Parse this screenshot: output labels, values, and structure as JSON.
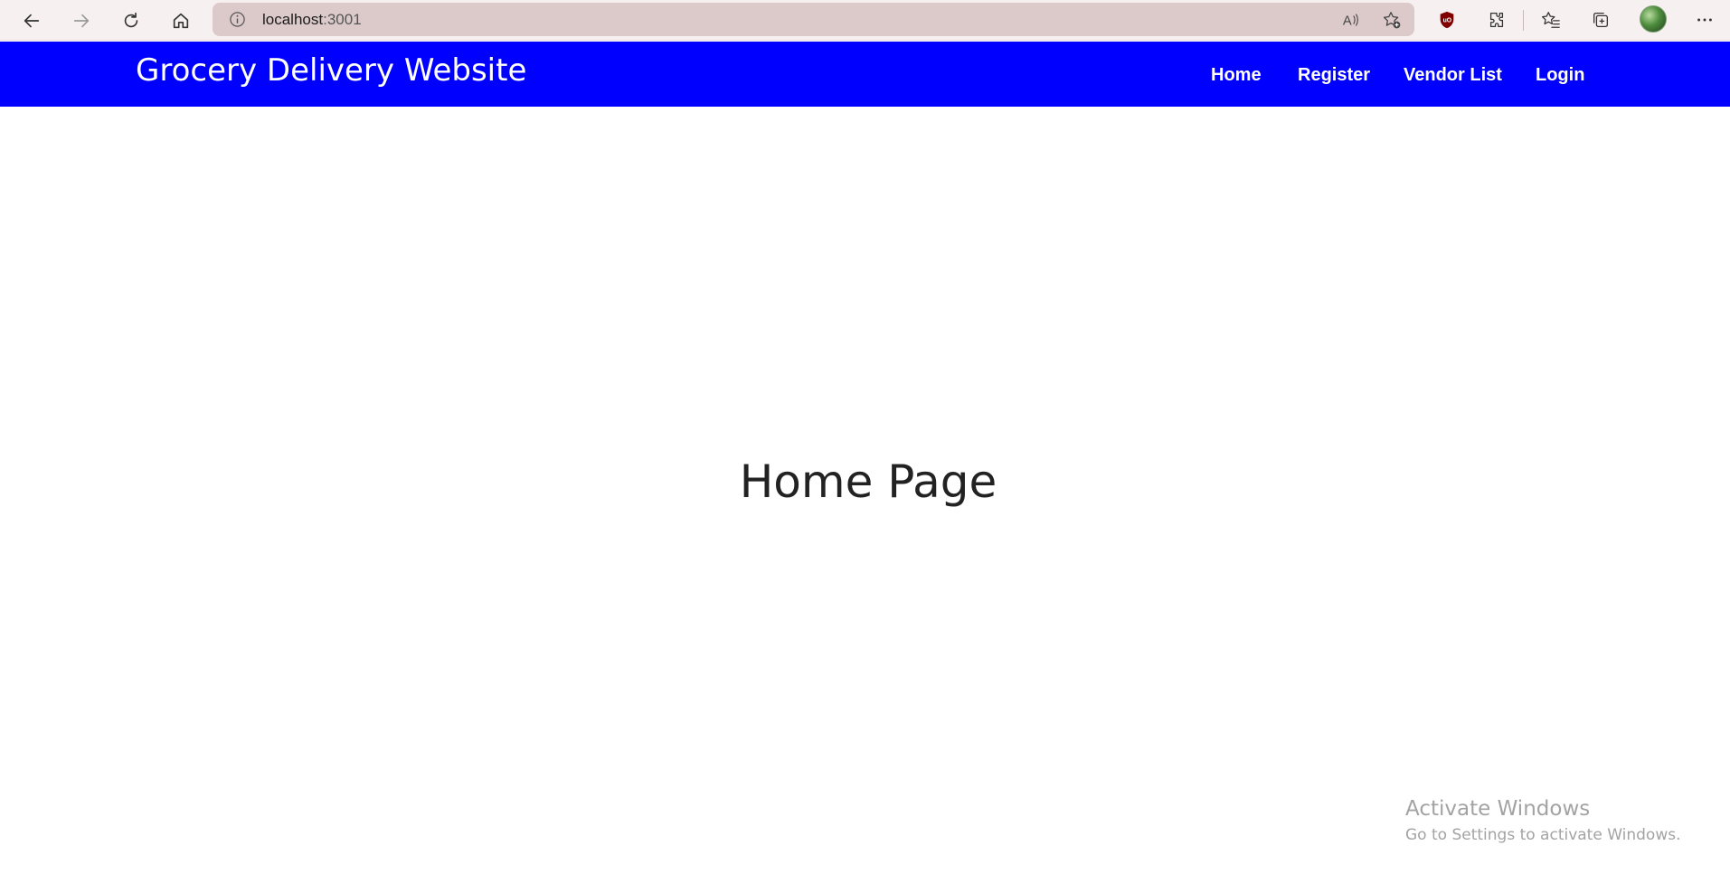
{
  "browser": {
    "url_host": "localhost",
    "url_port": ":3001",
    "icons": {
      "back": "back-arrow-icon",
      "forward": "forward-arrow-icon",
      "refresh": "refresh-icon",
      "home": "home-icon",
      "info": "info-icon",
      "read_aloud": "read-aloud-icon",
      "add_favorite": "add-favorite-icon",
      "ublock": "ublock-shield-icon",
      "extensions": "extensions-puzzle-icon",
      "favorites": "favorites-icon",
      "collections": "collections-icon",
      "profile": "profile-avatar",
      "more": "more-menu-icon"
    }
  },
  "header": {
    "brand": "Grocery Delivery Website",
    "background_color": "#0000ff",
    "nav": [
      {
        "label": "Home"
      },
      {
        "label": "Register"
      },
      {
        "label": "Vendor List"
      },
      {
        "label": "Login"
      }
    ]
  },
  "main": {
    "title": "Home Page"
  },
  "watermark": {
    "title": "Activate Windows",
    "subtitle": "Go to Settings to activate Windows."
  }
}
